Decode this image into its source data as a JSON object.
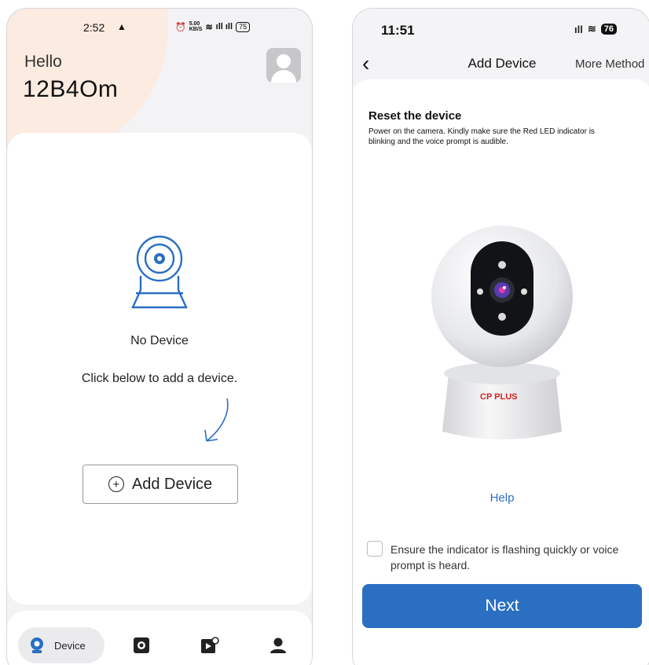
{
  "left_screen": {
    "status_bar": {
      "time": "2:52",
      "net_speed_top": "5.00",
      "net_speed_unit": "KB/S",
      "battery": "75"
    },
    "greeting": "Hello",
    "username": "12B4Om",
    "empty_state": {
      "title": "No Device",
      "subtitle": "Click below to add a device."
    },
    "add_device_label": "Add Device",
    "bottom_nav": {
      "device_label": "Device"
    }
  },
  "right_screen": {
    "status_bar": {
      "time": "11:51",
      "battery": "76"
    },
    "title": "Add Device",
    "more_method": "More Method",
    "reset_title": "Reset the device",
    "reset_desc": "Power on the camera. Kindly make sure the Red LED indicator is blinking and the voice prompt is audible.",
    "brand_logo": "CP PLUS",
    "help": "Help",
    "checkbox_label": "Ensure the indicator is flashing quickly or voice prompt is heard.",
    "next": "Next"
  },
  "colors": {
    "accent_blue": "#2a6fc1",
    "peach": "#fbebe0",
    "brand_red": "#d32222"
  }
}
